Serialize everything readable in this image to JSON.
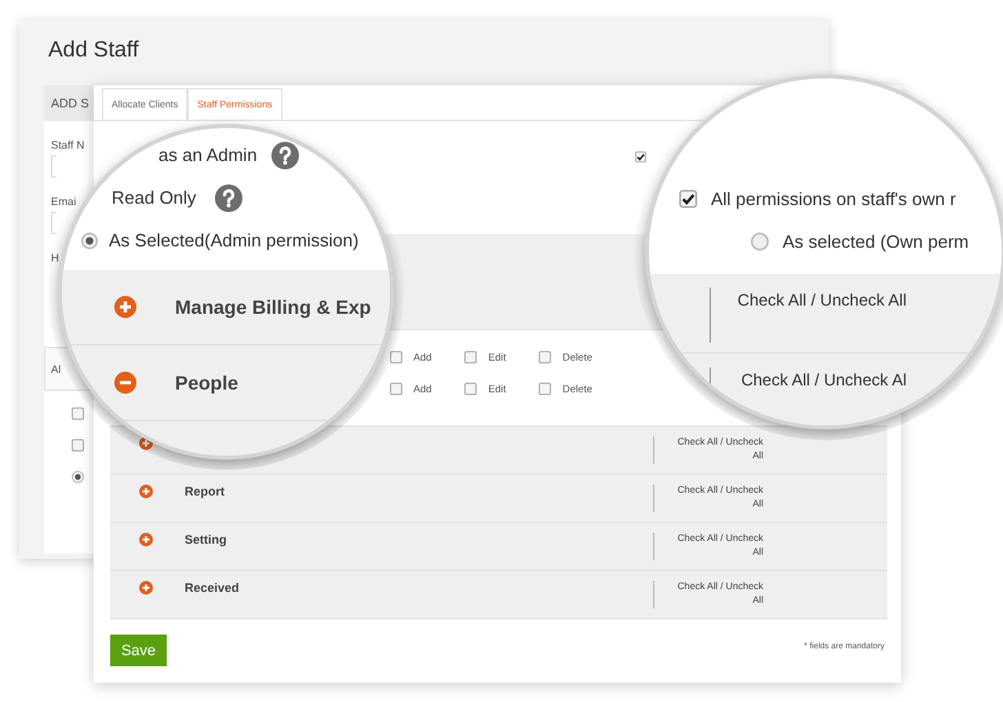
{
  "back_window": {
    "title": "Add Staff",
    "header": "ADD S",
    "fields": [
      {
        "label": "Staff N"
      },
      {
        "label": "Emai"
      }
    ],
    "label_3": "H",
    "tab": "Al",
    "options": [
      {
        "kind": "checkbox",
        "checked": false
      },
      {
        "kind": "checkbox",
        "checked": false
      },
      {
        "kind": "radio",
        "selected": true
      }
    ]
  },
  "front_window": {
    "tabs": [
      {
        "label": "Allocate Clients",
        "selected": false
      },
      {
        "label": "Staff Permissions",
        "selected": true
      }
    ],
    "own_records_checked": true,
    "modules": [
      {
        "expanded": false
      },
      {
        "expanded": true,
        "permissions": [
          [
            {
              "label": "Add",
              "checked": false
            },
            {
              "label": "Edit",
              "checked": false
            },
            {
              "label": "Delete",
              "checked": false
            }
          ],
          [
            {
              "label": "Add",
              "checked": false
            },
            {
              "label": "Edit",
              "checked": false
            },
            {
              "label": "Delete",
              "checked": false
            }
          ]
        ]
      },
      {
        "expanded": false,
        "check_all": "Check All / Uncheck All"
      },
      {
        "expanded": false,
        "name": "Report",
        "check_all": "Check All / Uncheck All"
      },
      {
        "expanded": false,
        "name": "Setting",
        "check_all": "Check All / Uncheck All"
      },
      {
        "expanded": false,
        "name": "Received",
        "check_all": "Check All / Uncheck All"
      }
    ],
    "save": "Save",
    "note": "* fields are mandatory"
  },
  "left_lens": {
    "options": [
      {
        "kind": "plain",
        "label": "as an Admin",
        "help": true
      },
      {
        "kind": "plain",
        "label": "Read Only",
        "help": true
      },
      {
        "kind": "radio",
        "label": "As Selected(Admin permission)",
        "selected": true
      }
    ],
    "modules": [
      {
        "name": "Manage Billing & Exp",
        "expanded": false
      },
      {
        "name": "People",
        "expanded": true
      }
    ]
  },
  "right_lens": {
    "own_records": {
      "label": "All permissions on staff's own r",
      "checked": true
    },
    "own_option": {
      "label": "As selected (Own perm",
      "selected": false
    },
    "check_all": [
      "Check All / Uncheck All",
      "Check All / Uncheck Al"
    ]
  }
}
